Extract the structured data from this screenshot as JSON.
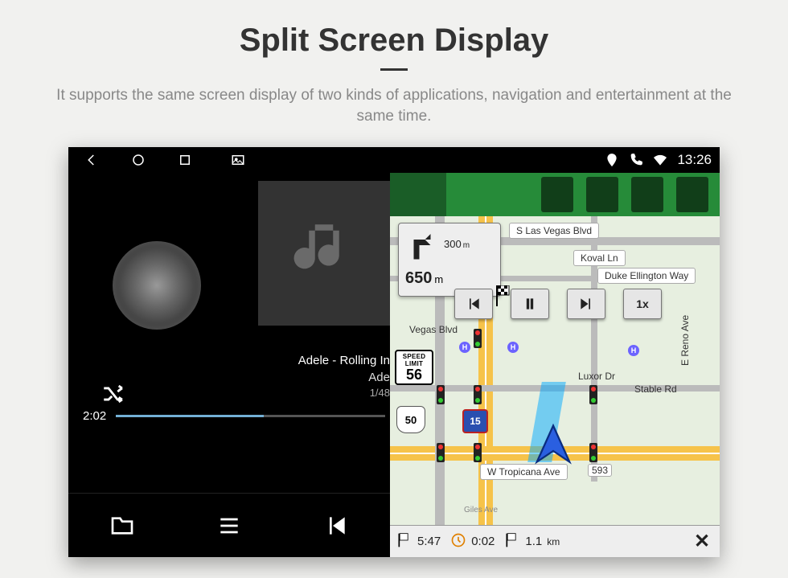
{
  "page": {
    "title": "Split Screen Display",
    "subtitle": "It supports the same screen display of two kinds of applications, navigation and entertainment at the same time."
  },
  "statusbar": {
    "time": "13:26"
  },
  "music": {
    "track_line1": "Adele - Rolling In",
    "track_line2": "Ade",
    "counter": "1/48",
    "elapsed": "2:02"
  },
  "nav": {
    "turn": {
      "then_dist": "300",
      "then_unit": "m",
      "dist": "650",
      "unit": "m"
    },
    "speed_limit": {
      "label_top": "SPEED",
      "label_bottom": "LIMIT",
      "value": "56"
    },
    "highway_route": "50",
    "interstate": "15",
    "playback_speed": "1x",
    "streets": {
      "s_las_vegas": "S Las Vegas Blvd",
      "koval": "Koval Ln",
      "duke": "Duke Ellington Way",
      "vegas_blvd": "Vegas Blvd",
      "luxor": "Luxor Dr",
      "stable": "Stable Rd",
      "reno": "E Reno Ave",
      "tropicana": "W Tropicana Ave",
      "tropicana_num": "593",
      "giles": "Giles Ave"
    },
    "bottom": {
      "eta": "5:47",
      "time_remaining": "0:02",
      "distance": "1.1",
      "distance_unit": "km"
    }
  }
}
